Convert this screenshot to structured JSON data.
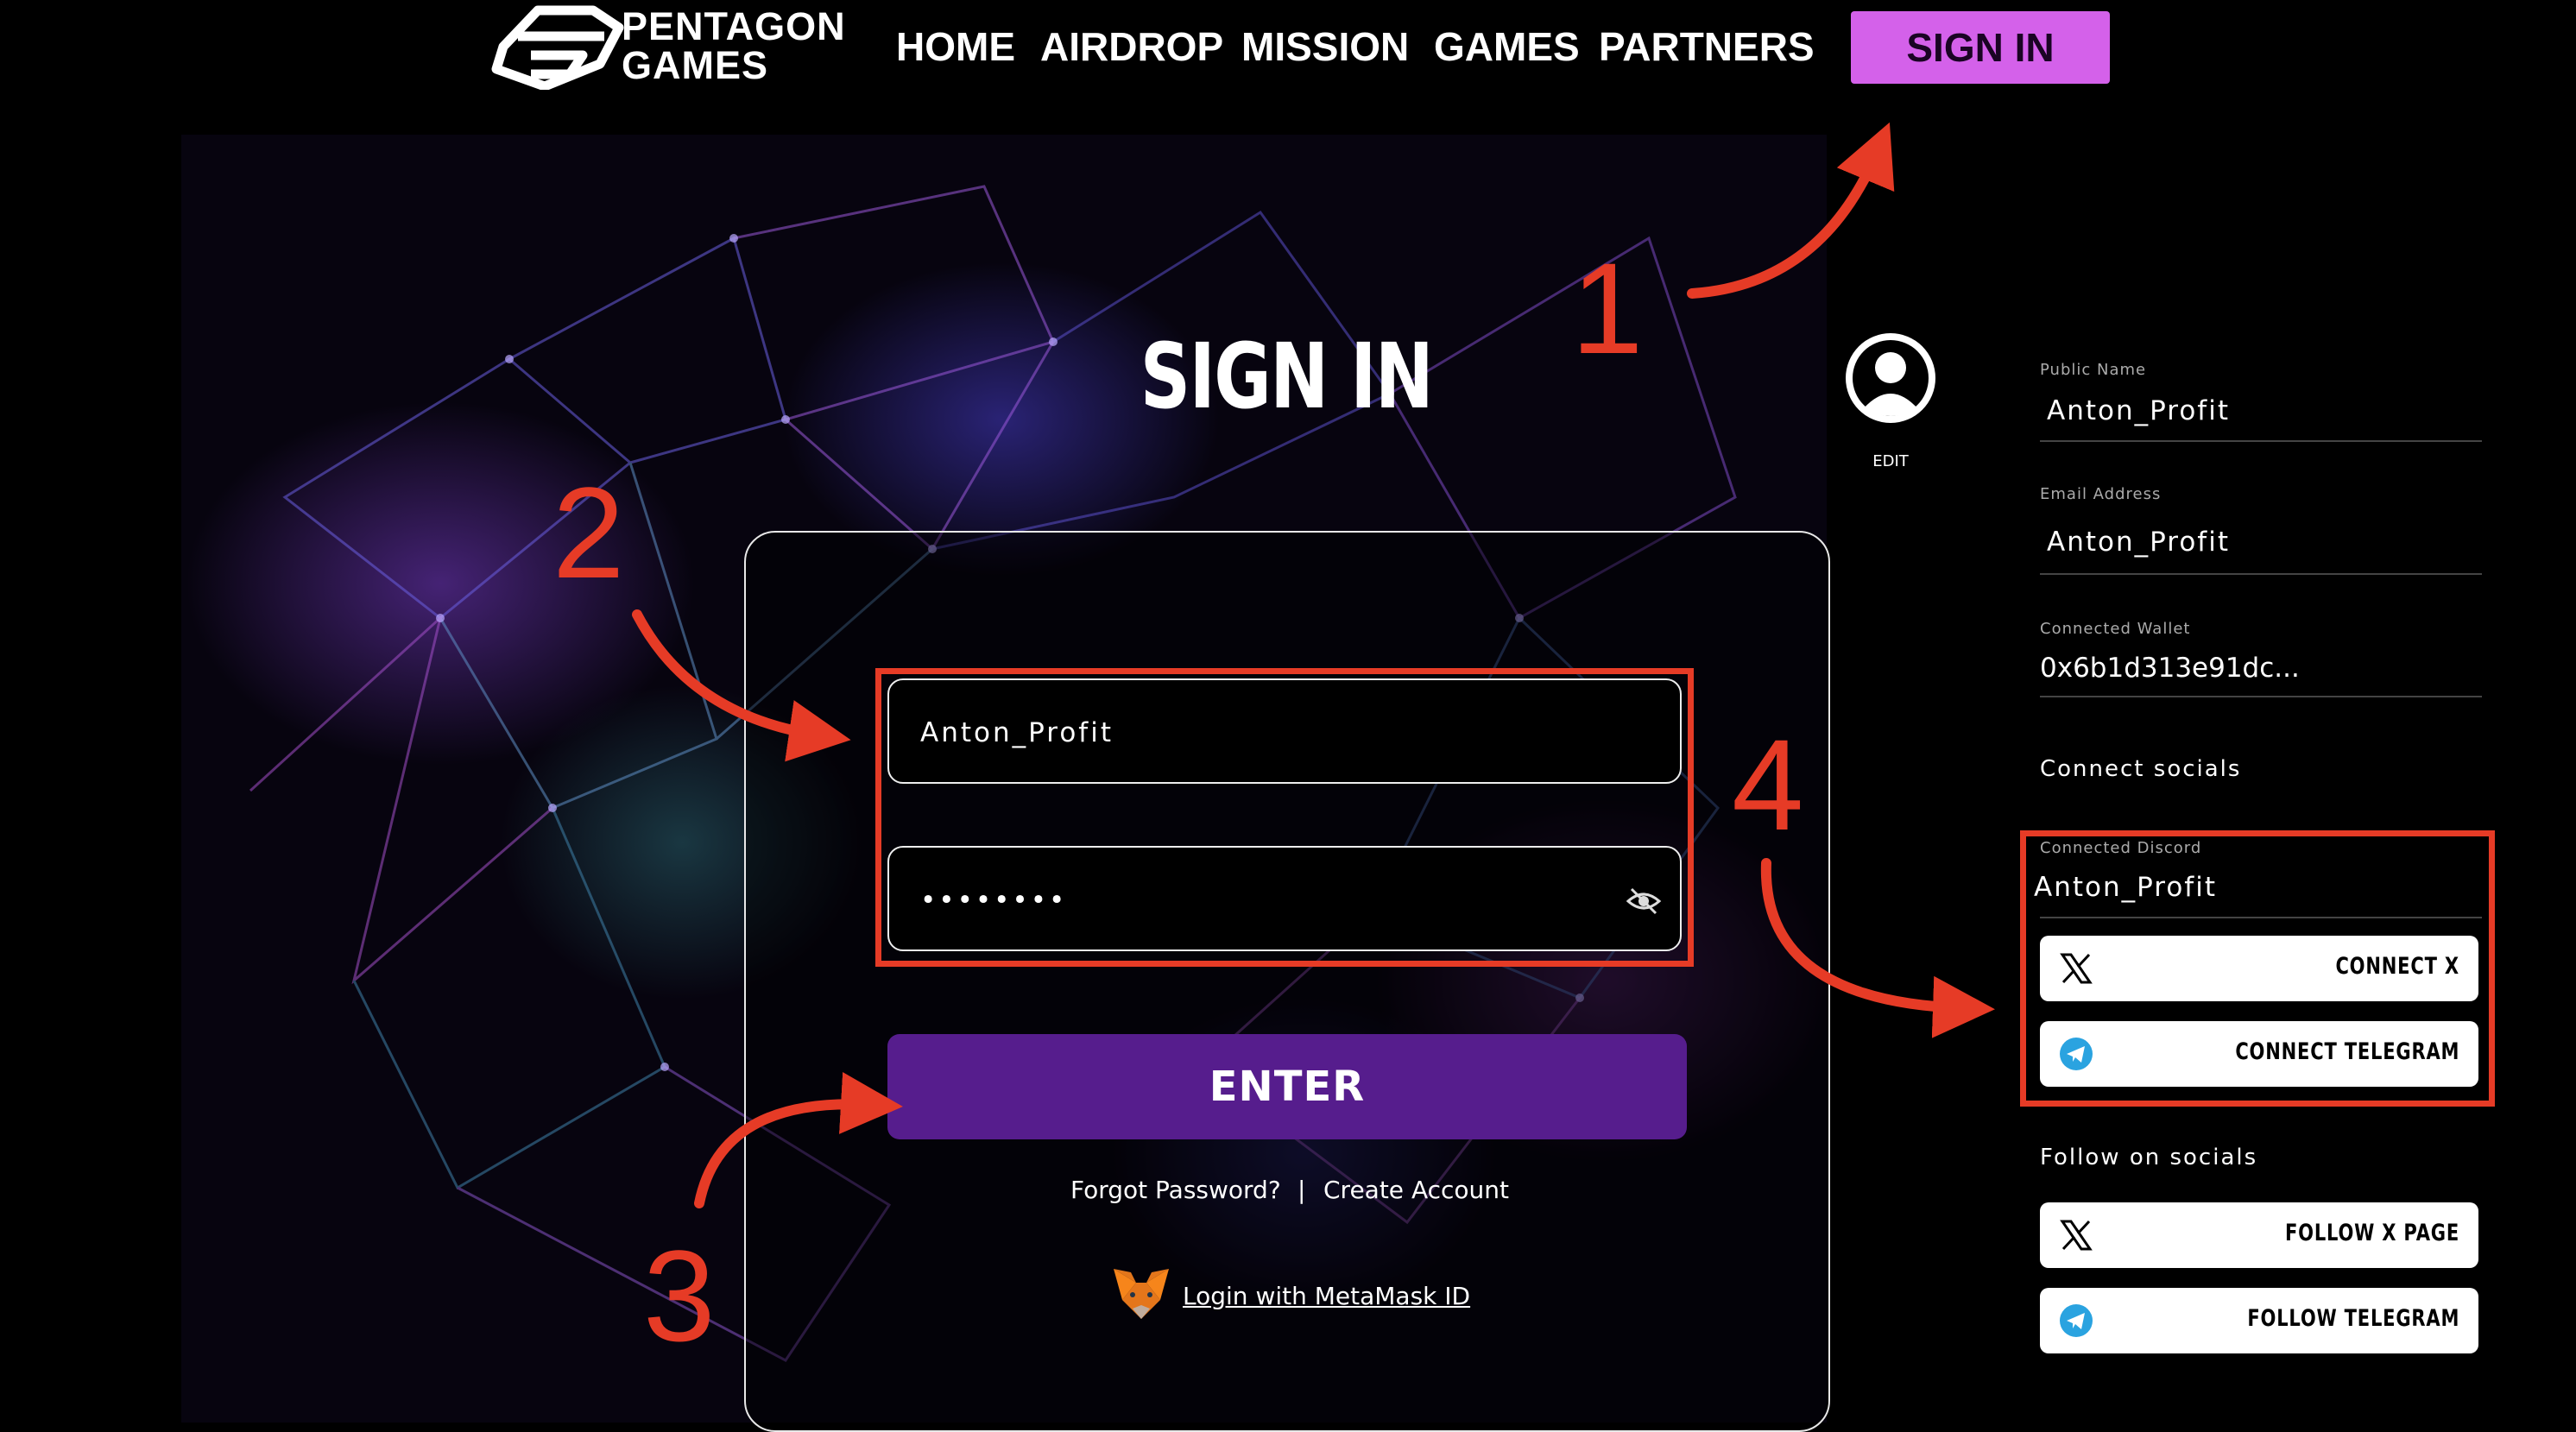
{
  "header": {
    "logo_line1": "PENTAGON",
    "logo_line2": "GAMES",
    "nav": [
      "HOME",
      "AIRDROP",
      "MISSION",
      "GAMES",
      "PARTNERS"
    ],
    "signin_button": "SIGN IN"
  },
  "login": {
    "title": "SIGN IN",
    "username_value": "Anton_Profit",
    "password_value": "••••••••",
    "enter_button": "ENTER",
    "forgot_password": "Forgot Password?",
    "separator": "|",
    "create_account": "Create Account",
    "metamask_link": "Login with MetaMask ID"
  },
  "profile": {
    "edit_label": "EDIT",
    "public_name_label": "Public Name",
    "public_name_value": "Anton_Profit",
    "email_label": "Email Address",
    "email_value": "Anton_Profit",
    "wallet_label": "Connected Wallet",
    "wallet_value": "0x6b1d313e91dc...",
    "connect_socials_heading": "Connect socials",
    "discord_label": "Connected Discord",
    "discord_value": "Anton_Profit",
    "connect_x": "CONNECT X",
    "connect_telegram": "CONNECT TELEGRAM",
    "follow_heading": "Follow on socials",
    "follow_x": "FOLLOW X PAGE",
    "follow_telegram": "FOLLOW TELEGRAM"
  },
  "annotations": {
    "num1": "1",
    "num2": "2",
    "num3": "3",
    "num4": "4"
  },
  "colors": {
    "accent_pink": "#d461ea",
    "enter_purple": "#561d8d",
    "annotation_red": "#e63b26",
    "telegram_blue": "#2aa3e0"
  }
}
